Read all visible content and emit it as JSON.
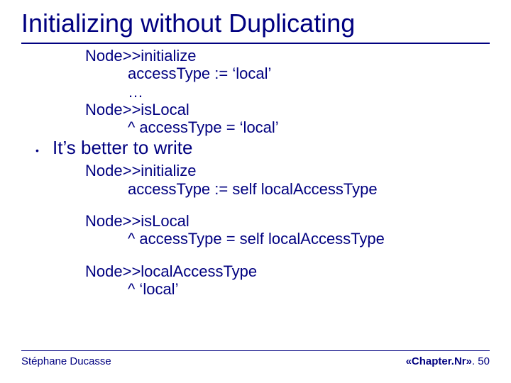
{
  "title": "Initializing without Duplicating",
  "code1": {
    "l1": "Node>>initialize",
    "l2": "accessType := ‘local’",
    "l3": "…",
    "l4": "Node>>isLocal",
    "l5": "^ accessType = ‘local’"
  },
  "bullet": "It’s better to write",
  "code2": {
    "l1": "Node>>initialize",
    "l2": "accessType := self localAccessType",
    "l3": "Node>>isLocal",
    "l4": "^ accessType = self localAccessType",
    "l5": "Node>>localAccessType",
    "l6": "^ ‘local’"
  },
  "footer": {
    "author": "Stéphane Ducasse",
    "chapter": "«Chapter.Nr»",
    "page_suffix": ". 50"
  }
}
